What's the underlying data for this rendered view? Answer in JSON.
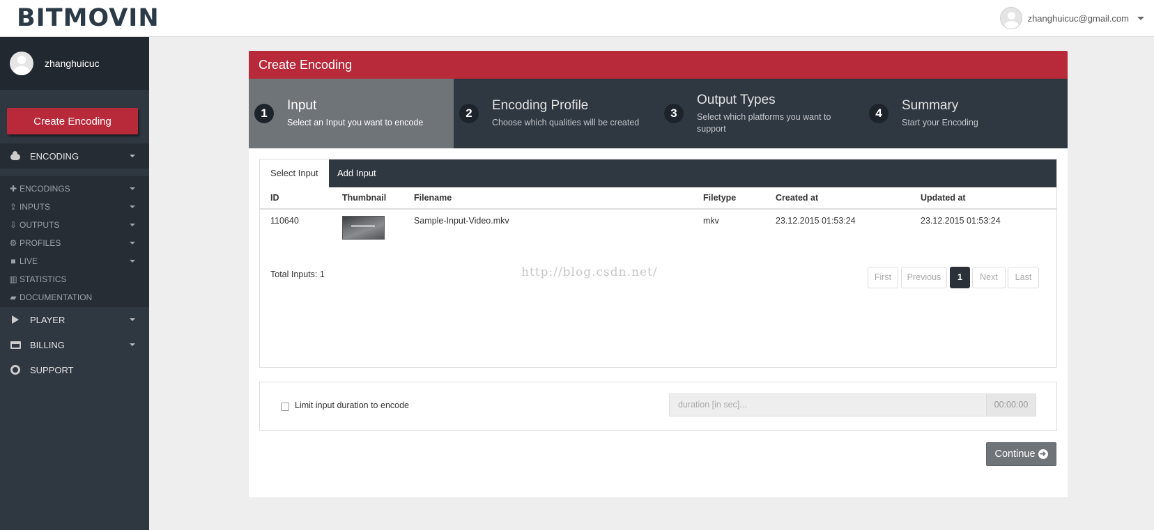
{
  "app": {
    "logo": "BITMOVIN"
  },
  "topbar": {
    "user_email": "zhanghuicuc@gmail.com"
  },
  "sidebar": {
    "username": "zhanghuicuc",
    "create_button": "Create Encoding",
    "encoding_label": "ENCODING",
    "sub_items": [
      {
        "label": "ENCODINGS",
        "icon": "plus-icon",
        "glyph": "✚"
      },
      {
        "label": "INPUTS",
        "icon": "upload-icon",
        "glyph": "⇪"
      },
      {
        "label": "OUTPUTS",
        "icon": "download-icon",
        "glyph": "⇩"
      },
      {
        "label": "PROFILES",
        "icon": "cogs-icon",
        "glyph": "⚙"
      },
      {
        "label": "LIVE",
        "icon": "video-camera-icon",
        "glyph": "■"
      },
      {
        "label": "STATISTICS",
        "icon": "bar-chart-icon",
        "glyph": "▥"
      },
      {
        "label": "DOCUMENTATION",
        "icon": "book-icon",
        "glyph": "▰"
      }
    ],
    "player_label": "PLAYER",
    "billing_label": "BILLING",
    "support_label": "SUPPORT"
  },
  "panel": {
    "title": "Create Encoding",
    "steps": [
      {
        "num": "1",
        "title": "Input",
        "sub": "Select an Input you want to encode"
      },
      {
        "num": "2",
        "title": "Encoding Profile",
        "sub": "Choose which qualities will be created"
      },
      {
        "num": "3",
        "title": "Output Types",
        "sub": "Select which platforms you want to support"
      },
      {
        "num": "4",
        "title": "Summary",
        "sub": "Start your Encoding"
      }
    ],
    "tabs": {
      "select": "Select Input",
      "add": "Add Input"
    },
    "table": {
      "headers": [
        "ID",
        "Thumbnail",
        "Filename",
        "Filetype",
        "Created at",
        "Updated at"
      ],
      "rows": [
        {
          "id": "110640",
          "filename": "Sample-Input-Video.mkv",
          "filetype": "mkv",
          "created": "23.12.2015 01:53:24",
          "updated": "23.12.2015 01:53:24"
        }
      ]
    },
    "total_inputs": "Total Inputs: 1",
    "watermark": "http://blog.csdn.net/",
    "pagination": {
      "first": "First",
      "previous": "Previous",
      "current": "1",
      "next": "Next",
      "last": "Last"
    },
    "limit": {
      "label": "Limit input duration to encode",
      "placeholder": "duration [in sec]...",
      "addon": "00:00:00"
    },
    "continue_label": "Continue"
  },
  "colors": {
    "brand_red": "#b8293a",
    "sidebar": "#2f3740",
    "active_step": "#6f7479"
  }
}
